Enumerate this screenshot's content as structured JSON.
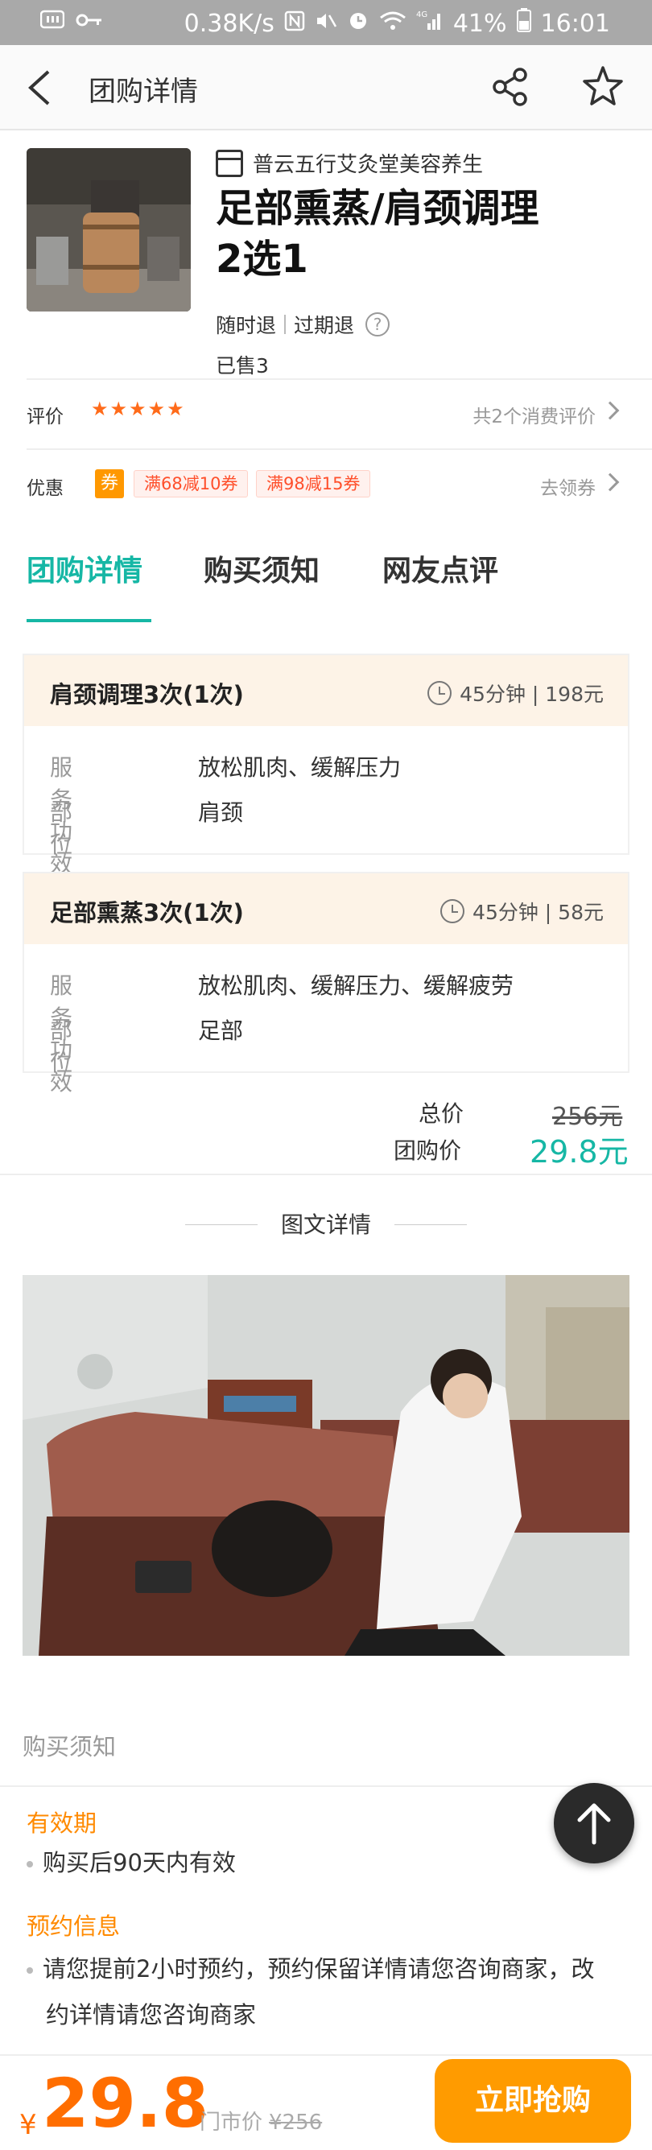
{
  "status_bar": {
    "network_speed": "0.38K/s",
    "battery": "41%",
    "time": "16:01",
    "left_icons": [
      "qiyi-icon",
      "key-icon"
    ],
    "right_icons": [
      "nfc-icon",
      "mute-icon",
      "alarm-icon",
      "wifi-icon",
      "signal-4g-icon",
      "battery-icon"
    ]
  },
  "navbar": {
    "title": "团购详情"
  },
  "product": {
    "merchant": "普云五行艾灸堂美容养生",
    "title": "足部熏蒸/肩颈调理2选1",
    "refund_any_time": "随时退",
    "refund_expired": "过期退",
    "sold": "已售3"
  },
  "rating": {
    "label": "评价",
    "stars": 5,
    "summary": "共2个消费评价"
  },
  "coupons": {
    "label": "优惠",
    "badge": "券",
    "items": [
      "满68减10券",
      "满98减15券"
    ],
    "action": "去领券"
  },
  "tabs": [
    {
      "label": "团购详情",
      "active": true
    },
    {
      "label": "购买须知",
      "active": false
    },
    {
      "label": "网友点评",
      "active": false
    }
  ],
  "services": [
    {
      "name": "肩颈调理3次(1次)",
      "meta": "45分钟 | 198元",
      "rows": [
        {
          "key": "服务功效",
          "value": "放松肌肉、缓解压力"
        },
        {
          "key": "部位",
          "value": "肩颈"
        }
      ]
    },
    {
      "name": "足部熏蒸3次(1次)",
      "meta": "45分钟 | 58元",
      "rows": [
        {
          "key": "服务功效",
          "value": "放松肌肉、缓解压力、缓解疲劳"
        },
        {
          "key": "部位",
          "value": "足部"
        }
      ]
    }
  ],
  "prices": {
    "total_label": "总价",
    "total_value": "256元",
    "group_label": "团购价",
    "group_value": "29.8元"
  },
  "detail": {
    "title": "图文详情"
  },
  "notice": {
    "header": "购买须知",
    "validity_title": "有效期",
    "validity_item": "购买后90天内有效",
    "booking_title": "预约信息",
    "booking_item_line1": "请您提前2小时预约，预约保留详情请您咨询商家，改",
    "booking_item_line2": "约详情请您咨询商家"
  },
  "bottom_bar": {
    "currency": "¥",
    "price": "29.8",
    "store_price_label": "门市价",
    "store_price_value": "¥256",
    "buy_button": "立即抢购"
  },
  "colors": {
    "accent": "#16b7a5",
    "price_orange": "#ff6e00",
    "button_orange": "#ff9b00",
    "star_orange": "#ff6b1a",
    "coupon_red": "#ff4f2b",
    "card_header_bg": "#fdf3e7"
  }
}
